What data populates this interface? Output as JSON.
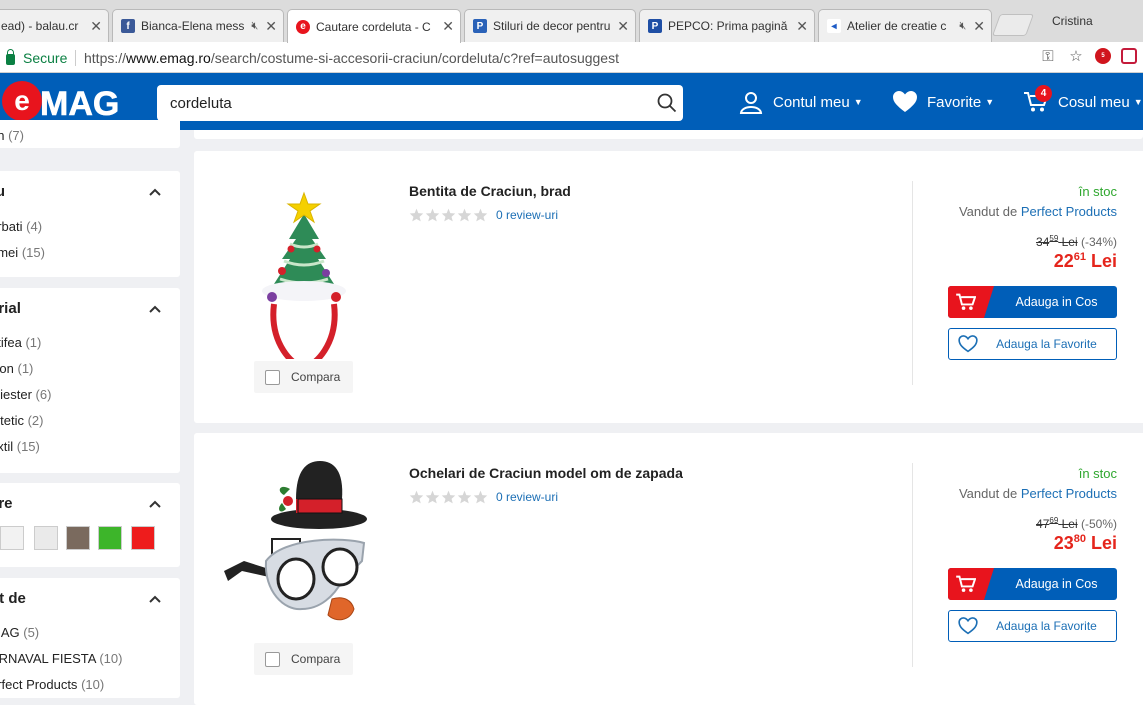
{
  "browser": {
    "tabs": [
      {
        "title": "ead) - balau.cr",
        "favicon": "doc-icon",
        "muted": false
      },
      {
        "title": "Bianca-Elena mess",
        "favicon": "facebook-icon",
        "muted": true
      },
      {
        "title": "Cautare cordeluta - C",
        "favicon": "emag-icon",
        "muted": false,
        "active": true
      },
      {
        "title": "Stiluri de decor pentru",
        "favicon": "p-icon",
        "muted": false
      },
      {
        "title": "PEPCO: Prima pagină",
        "favicon": "pepco-icon",
        "muted": false
      },
      {
        "title": "Atelier de creatie c",
        "favicon": "carrefour-icon",
        "muted": true
      }
    ],
    "profile": "Cristina",
    "secure_label": "Secure",
    "url_prefix": "https://",
    "url_host": "www.emag.ro",
    "url_path": "/search/costume-si-accesorii-craciun/cordeluta/c?ref=autosuggest",
    "abp_count": "5"
  },
  "header": {
    "logo": "eMAG",
    "search_value": "cordeluta",
    "account": "Contul meu",
    "favorites": "Favorite",
    "cart": "Cosul meu",
    "cart_count": "4"
  },
  "sidebar": {
    "top_item": {
      "label": "en",
      "count": "(7)"
    },
    "groups": [
      {
        "title": "ru",
        "items": [
          {
            "label": "arbati",
            "count": "(4)"
          },
          {
            "label": "emei",
            "count": "(15)"
          }
        ]
      },
      {
        "title": "erial",
        "items": [
          {
            "label": "atifea",
            "count": "(1)"
          },
          {
            "label": "ylon",
            "count": "(1)"
          },
          {
            "label": "oliester",
            "count": "(6)"
          },
          {
            "label": "intetic",
            "count": "(2)"
          },
          {
            "label": "extil",
            "count": "(15)"
          }
        ]
      },
      {
        "title": "are",
        "swatches": [
          "#f2f2f2",
          "#eaeaea",
          "#7a6a5e",
          "#3db52a",
          "#ee1c1c"
        ]
      },
      {
        "title": "ut de",
        "items": [
          {
            "label": "MAG",
            "count": "(5)"
          },
          {
            "label": "ARNAVAL FIESTA",
            "count": "(10)"
          },
          {
            "label": "erfect Products",
            "count": "(10)"
          }
        ]
      }
    ]
  },
  "products": [
    {
      "title": "Bentita de Craciun, brad",
      "rating": 0,
      "reviews": "0 review-uri",
      "compare": "Compara",
      "stock": "în stoc",
      "seller_prefix": "Vandut de",
      "seller": "Perfect Products",
      "old_int": "34",
      "old_dec": "59",
      "old_cur": "Lei",
      "discount": "(-34%)",
      "price_int": "22",
      "price_dec": "61",
      "price_cur": "Lei",
      "add_to_cart": "Adauga in Cos",
      "add_to_fav": "Adauga la Favorite"
    },
    {
      "title": "Ochelari de Craciun model om de zapada",
      "rating": 0,
      "reviews": "0 review-uri",
      "compare": "Compara",
      "stock": "în stoc",
      "seller_prefix": "Vandut de",
      "seller": "Perfect Products",
      "old_int": "47",
      "old_dec": "69",
      "old_cur": "Lei",
      "discount": "(-50%)",
      "price_int": "23",
      "price_dec": "80",
      "price_cur": "Lei",
      "add_to_cart": "Adauga in Cos",
      "add_to_fav": "Adauga la Favorite"
    }
  ]
}
